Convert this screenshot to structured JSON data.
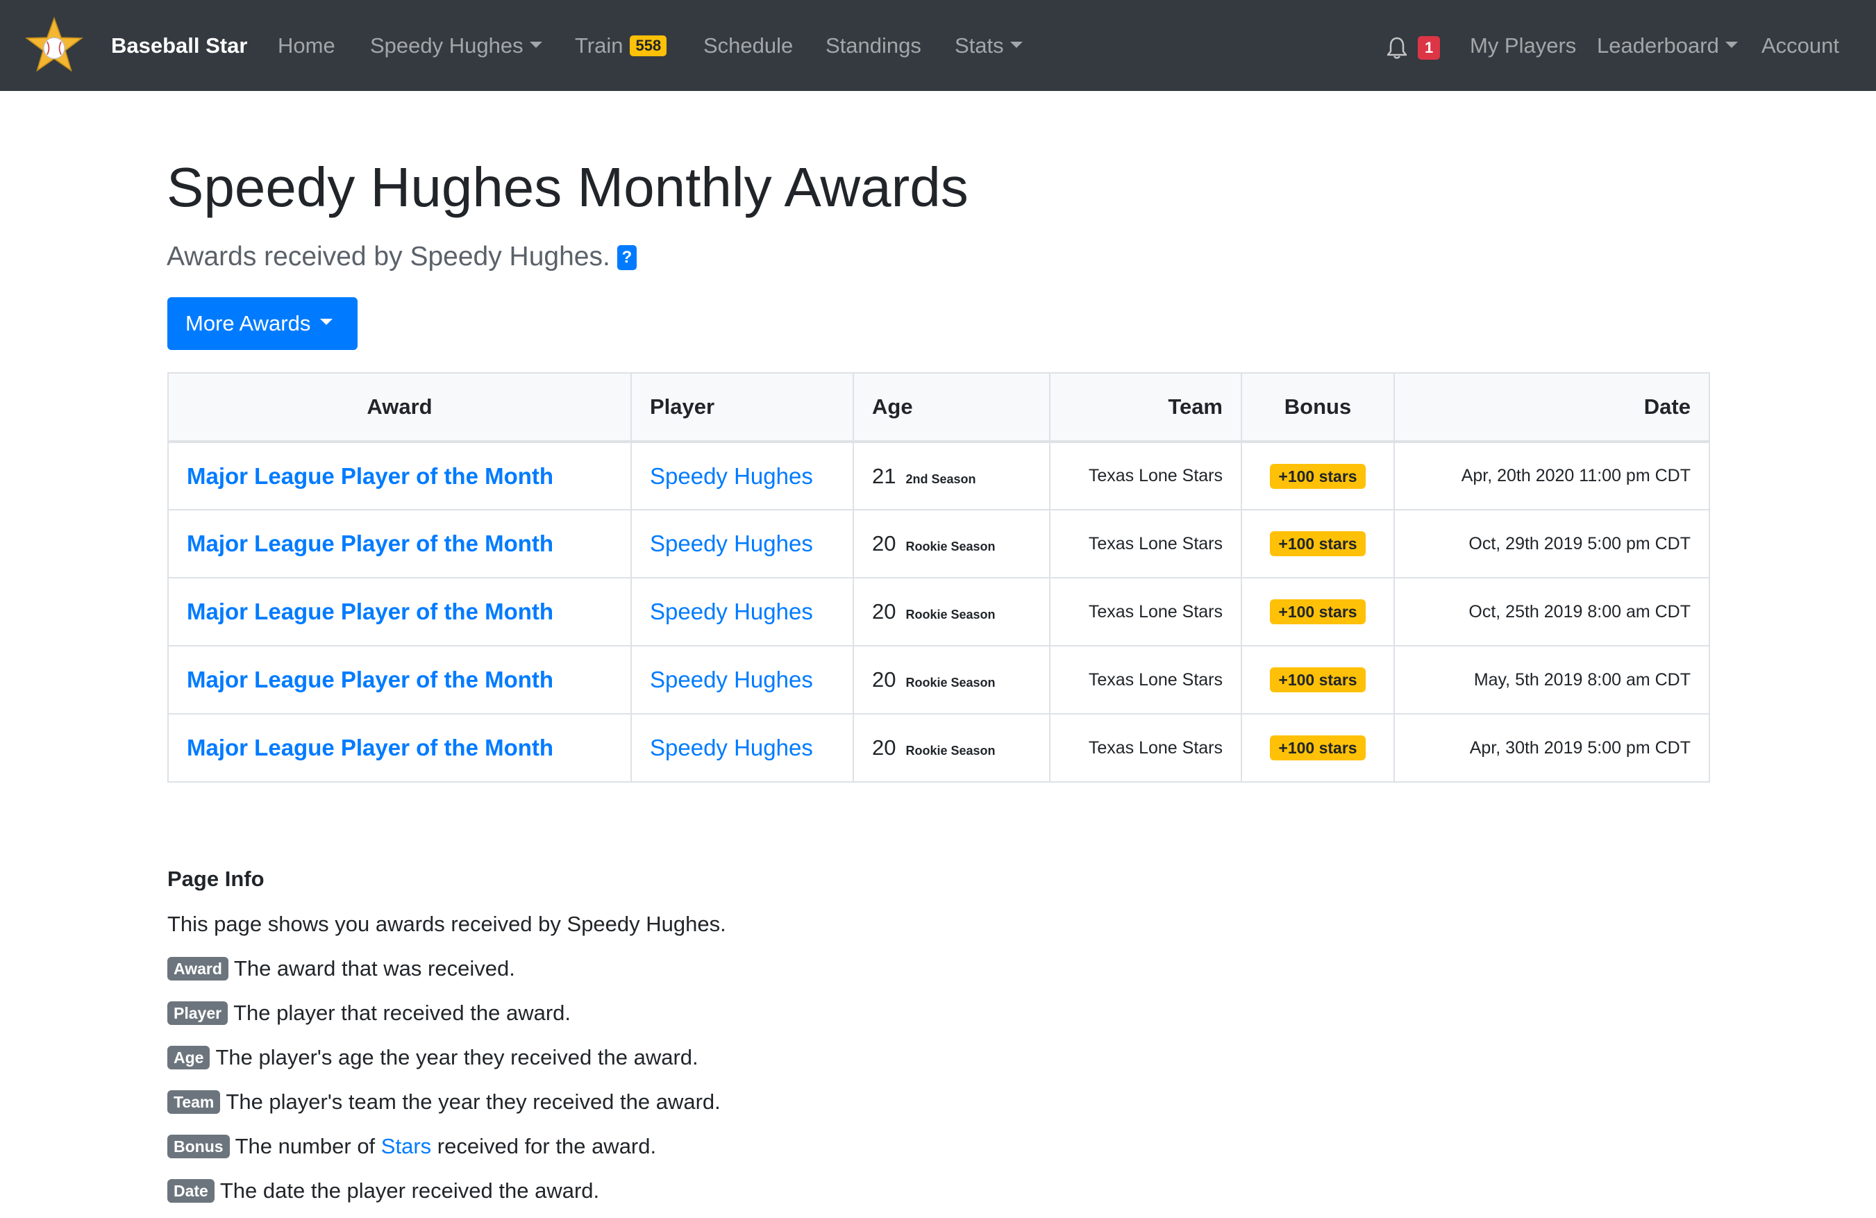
{
  "nav": {
    "brand": "Baseball Star",
    "home": "Home",
    "player_menu": "Speedy Hughes",
    "train": "Train",
    "train_count": "558",
    "schedule": "Schedule",
    "standings": "Standings",
    "stats": "Stats",
    "notification_count": "1",
    "my_players": "My Players",
    "leaderboard": "Leaderboard",
    "account": "Account"
  },
  "header": {
    "title": "Speedy Hughes Monthly Awards",
    "subtitle": "Awards received by Speedy Hughes.",
    "help_badge": "?"
  },
  "more_awards_button": "More Awards",
  "table": {
    "columns": [
      "Award",
      "Player",
      "Age",
      "Team",
      "Bonus",
      "Date"
    ],
    "rows": [
      {
        "award": "Major League Player of the Month",
        "player": "Speedy Hughes",
        "age": "21",
        "season": "2nd Season",
        "team": "Texas Lone Stars",
        "bonus": "+100 stars",
        "date": "Apr, 20th 2020 11:00 pm CDT"
      },
      {
        "award": "Major League Player of the Month",
        "player": "Speedy Hughes",
        "age": "20",
        "season": "Rookie Season",
        "team": "Texas Lone Stars",
        "bonus": "+100 stars",
        "date": "Oct, 29th 2019 5:00 pm CDT"
      },
      {
        "award": "Major League Player of the Month",
        "player": "Speedy Hughes",
        "age": "20",
        "season": "Rookie Season",
        "team": "Texas Lone Stars",
        "bonus": "+100 stars",
        "date": "Oct, 25th 2019 8:00 am CDT"
      },
      {
        "award": "Major League Player of the Month",
        "player": "Speedy Hughes",
        "age": "20",
        "season": "Rookie Season",
        "team": "Texas Lone Stars",
        "bonus": "+100 stars",
        "date": "May, 5th 2019 8:00 am CDT"
      },
      {
        "award": "Major League Player of the Month",
        "player": "Speedy Hughes",
        "age": "20",
        "season": "Rookie Season",
        "team": "Texas Lone Stars",
        "bonus": "+100 stars",
        "date": "Apr, 30th 2019 5:00 pm CDT"
      }
    ]
  },
  "page_info": {
    "heading": "Page Info",
    "intro": "This page shows you awards received by Speedy Hughes.",
    "items": [
      {
        "badge": "Award",
        "text": "The award that was received."
      },
      {
        "badge": "Player",
        "text": "The player that received the award."
      },
      {
        "badge": "Age",
        "text": "The player's age the year they received the award."
      },
      {
        "badge": "Team",
        "text": "The player's team the year they received the award."
      },
      {
        "badge": "Bonus",
        "text_before": "The number of",
        "link": "Stars",
        "text_after": "received for the award."
      },
      {
        "badge": "Date",
        "text": "The date the player received the award."
      }
    ]
  },
  "colors": {
    "navbar": "#343a40",
    "primary": "#007bff",
    "warning": "#ffc107",
    "danger": "#dc3545",
    "secondary": "#6c757d"
  },
  "icons": {
    "logo": "star-baseball-logo",
    "notification": "bell-icon"
  }
}
